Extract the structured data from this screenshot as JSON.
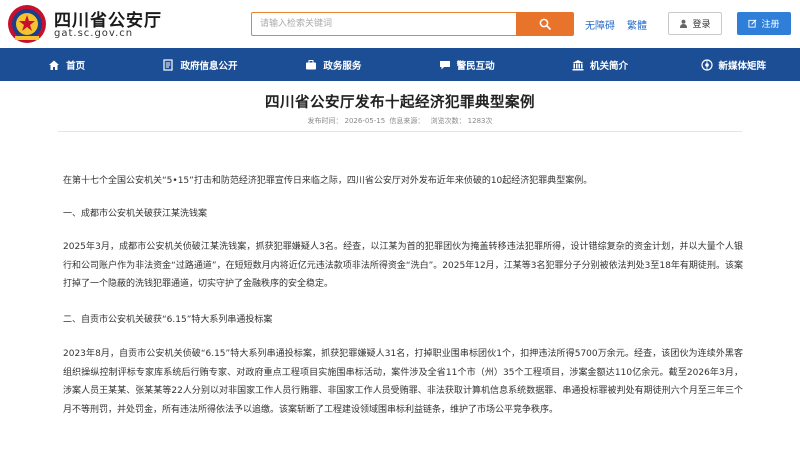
{
  "header": {
    "site_title": "四川省公安厅",
    "site_domain": "gat.sc.gov.cn",
    "search_placeholder": "请输入检索关键词",
    "accessibility_label": "无障碍",
    "traditional_label": "繁體",
    "login_label": "登录",
    "register_label": "注册"
  },
  "nav": {
    "items": [
      {
        "label": "首页",
        "icon": "home-icon"
      },
      {
        "label": "政府信息公开",
        "icon": "document-icon"
      },
      {
        "label": "政务服务",
        "icon": "briefcase-icon"
      },
      {
        "label": "警民互动",
        "icon": "chat-icon"
      },
      {
        "label": "机关简介",
        "icon": "building-icon"
      },
      {
        "label": "新媒体矩阵",
        "icon": "network-icon"
      }
    ]
  },
  "article": {
    "title": "四川省公安厅发布十起经济犯罪典型案例",
    "publish_label": "发布时间：",
    "publish_date": "2026-05-15",
    "source_label": "信息来源：",
    "source_value": "",
    "views_label": "浏览次数：",
    "views_count": "1283次",
    "intro": "在第十七个全国公安机关“5•15”打击和防范经济犯罪宣传日来临之际，四川省公安厅对外发布近年来侦破的10起经济犯罪典型案例。",
    "section1_heading": "一、成都市公安机关破获江某洗钱案",
    "section1_body": "2025年3月，成都市公安机关侦破江某洗钱案，抓获犯罪嫌疑人3名。经查，以江某为首的犯罪团伙为掩盖转移违法犯罪所得，设计错综复杂的资金计划，并以大量个人银行和公司账户作为非法资金“过路通道”，在短短数月内将近亿元违法款项非法所得资金“洗白”。2025年12月，江某等3名犯罪分子分别被依法判处3至18年有期徒刑。该案打掉了一个隐蔽的洗钱犯罪通道，切实守护了金融秩序的安全稳定。",
    "section2_heading": "二、自贡市公安机关破获“6.15”特大系列串通投标案",
    "section2_body": "2023年8月，自贡市公安机关侦破“6.15”特大系列串通投标案，抓获犯罪嫌疑人31名，打掉职业围串标团伙1个，扣押违法所得5700万余元。经查，该团伙为连续外黑客组织操纵控制评标专家库系统后行贿专家、对政府重点工程项目实施围串标活动，案件涉及全省11个市（州）35个工程项目，涉案金额达110亿余元。截至2026年3月，涉案人员王某某、张某某等22人分别以对非国家工作人员行贿罪、非国家工作人员受贿罪、非法获取计算机信息系统数据罪、串通投标罪被判处有期徒刑六个月至三年三个月不等刑罚，并处罚金，所有违法所得依法予以追缴。该案斩断了工程建设领域围串标利益链条，维护了市场公平竞争秩序。"
  },
  "colors": {
    "nav_bg": "#1c4e95",
    "search_accent": "#e8742c",
    "register_bg": "#2f7fd8",
    "link": "#2a6ec9"
  }
}
